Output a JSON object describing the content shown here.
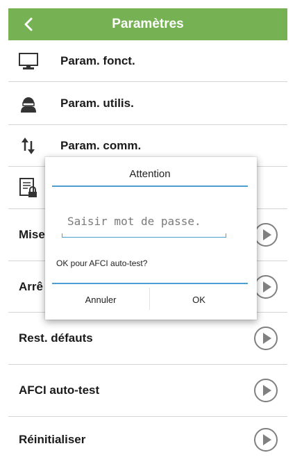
{
  "header": {
    "title": "Paramètres",
    "back_icon": "chevron-left-icon",
    "background": "#76b254"
  },
  "menu": [
    {
      "label": "Param. fonct.",
      "icon": "monitor-icon"
    },
    {
      "label": "Param. utilis.",
      "icon": "user-icon"
    },
    {
      "label": "Param. comm.",
      "icon": "up-down-arrows-icon"
    },
    {
      "label": "",
      "icon": "locked-document-icon"
    }
  ],
  "actions": [
    {
      "label": "Mise"
    },
    {
      "label": "Arrê"
    },
    {
      "label": "Rest. défauts"
    },
    {
      "label": "AFCI auto-test"
    },
    {
      "label": "Réinitialiser"
    }
  ],
  "dialog": {
    "title": "Attention",
    "password_placeholder": "Saisir mot de passe.",
    "message": "OK pour AFCI auto-test?",
    "cancel_label": "Annuler",
    "ok_label": "OK",
    "accent": "#4a9fd0"
  }
}
